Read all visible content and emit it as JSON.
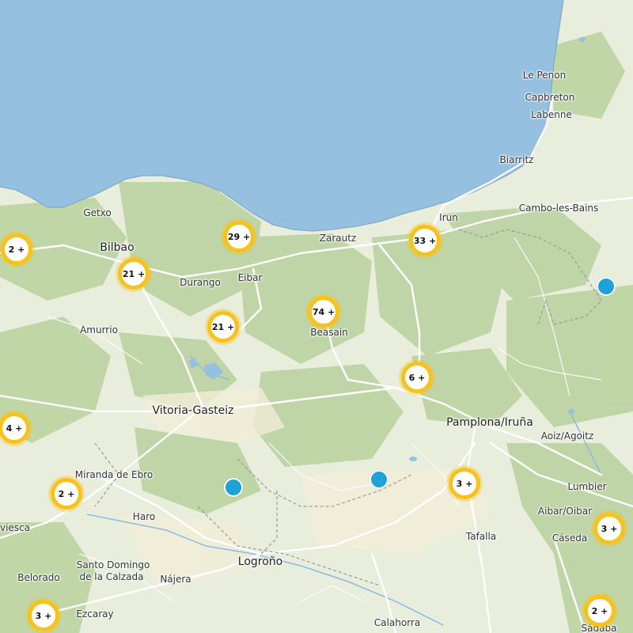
{
  "map": {
    "colors": {
      "sea": "#95c0e0",
      "land": "#e8eddc",
      "forest": "#b8d09c",
      "road": "#ffffff",
      "border": "#999999",
      "cluster": "#f7c21c",
      "point": "#1fa3d6"
    },
    "places": [
      {
        "id": "le-penon",
        "name": "Le Penon"
      },
      {
        "id": "capbreton",
        "name": "Capbreton"
      },
      {
        "id": "labenne",
        "name": "Labenne"
      },
      {
        "id": "biarritz",
        "name": "Biarritz"
      },
      {
        "id": "getxo",
        "name": "Getxo"
      },
      {
        "id": "irun",
        "name": "Irun"
      },
      {
        "id": "cambo",
        "name": "Cambo-les-Bains"
      },
      {
        "id": "bilbao",
        "name": "Bilbao"
      },
      {
        "id": "zarautz",
        "name": "Zarautz"
      },
      {
        "id": "durango",
        "name": "Durango"
      },
      {
        "id": "eibar",
        "name": "Eibar"
      },
      {
        "id": "amurrio",
        "name": "Amurrio"
      },
      {
        "id": "beasain",
        "name": "Beasain"
      },
      {
        "id": "vitoria",
        "name": "Vitoria-Gasteiz"
      },
      {
        "id": "pamplona",
        "name": "Pamplona/Iruña"
      },
      {
        "id": "aoiz",
        "name": "Aoiz/Agoitz"
      },
      {
        "id": "miranda",
        "name": "Miranda de Ebro"
      },
      {
        "id": "lumbier",
        "name": "Lumbier"
      },
      {
        "id": "haro",
        "name": "Haro"
      },
      {
        "id": "aibar",
        "name": "Aibar/Oibar"
      },
      {
        "id": "briviesca",
        "name": "viesca"
      },
      {
        "id": "tafalla",
        "name": "Tafalla"
      },
      {
        "id": "caseda",
        "name": "Cáseda"
      },
      {
        "id": "santo1",
        "name": "Santo Domingo"
      },
      {
        "id": "santo2",
        "name": "de la Calzada"
      },
      {
        "id": "logrono",
        "name": "Logroño"
      },
      {
        "id": "belorado",
        "name": "Belorado"
      },
      {
        "id": "najera",
        "name": "Nájera"
      },
      {
        "id": "ezcaray",
        "name": "Ezcaray"
      },
      {
        "id": "calahorra",
        "name": "Calahorra"
      },
      {
        "id": "sadaba",
        "name": "Sádaba"
      }
    ],
    "clusters": [
      {
        "id": "c1",
        "label": "2 +"
      },
      {
        "id": "c2",
        "label": "21 +"
      },
      {
        "id": "c3",
        "label": "29 +"
      },
      {
        "id": "c4",
        "label": "33 +"
      },
      {
        "id": "c5",
        "label": "74 +"
      },
      {
        "id": "c6",
        "label": "21 +"
      },
      {
        "id": "c7",
        "label": "6 +"
      },
      {
        "id": "c8",
        "label": "4 +"
      },
      {
        "id": "c9",
        "label": "2 +"
      },
      {
        "id": "c10",
        "label": "3 +"
      },
      {
        "id": "c11",
        "label": "3 +"
      },
      {
        "id": "c12",
        "label": "3 +"
      },
      {
        "id": "c13",
        "label": "2 +"
      }
    ],
    "points": [
      {
        "id": "p1"
      },
      {
        "id": "p2"
      },
      {
        "id": "p3"
      }
    ]
  }
}
